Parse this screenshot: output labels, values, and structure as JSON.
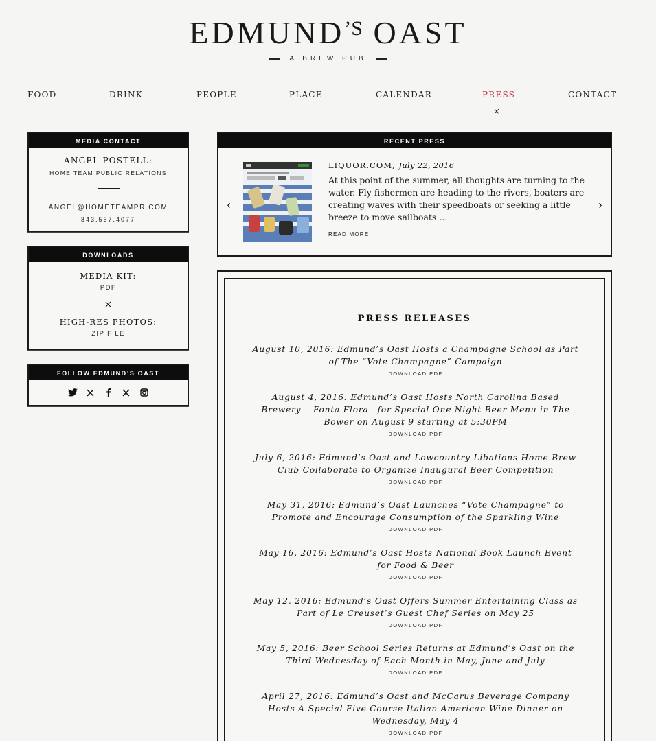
{
  "brand": {
    "name_main": "EDMUND",
    "name_apos": "’S",
    "name_end": "OAST",
    "tagline": "A BREW PUB"
  },
  "nav": {
    "items": [
      "FOOD",
      "DRINK",
      "PEOPLE",
      "PLACE",
      "CALENDAR",
      "PRESS",
      "CONTACT"
    ],
    "active": "PRESS",
    "active_mark": "×"
  },
  "media_contact": {
    "heading": "MEDIA CONTACT",
    "name": "ANGEL POSTELL:",
    "agency": "HOME TEAM PUBLIC RELATIONS",
    "email": "ANGEL@HOMETEAMPR.COM",
    "phone": "843.557.4077"
  },
  "downloads": {
    "heading": "DOWNLOADS",
    "media_kit_title": "MEDIA KIT:",
    "media_kit_link": "PDF",
    "separator": "×",
    "photos_title": "HIGH-RES PHOTOS:",
    "photos_link": "ZIP FILE"
  },
  "follow": {
    "heading": "FOLLOW EDMUND’S OAST",
    "icons": [
      "twitter-icon",
      "x-icon",
      "facebook-icon",
      "x-icon",
      "instagram-icon"
    ]
  },
  "recent_press": {
    "heading": "RECENT PRESS",
    "source": "LIQUOR.COM,",
    "date": "July 22, 2016",
    "excerpt": "At this point of the summer, all thoughts are turning to the water. Fly fishermen are heading to the rivers, boaters are creating waves with their speedboats or seeking a little breeze to move sailboats ...",
    "read_more": "READ MORE",
    "prev_arrow": "‹",
    "next_arrow": "›"
  },
  "press_releases": {
    "heading": "PRESS RELEASES",
    "download_label": "DOWNLOAD PDF",
    "items": [
      {
        "title": "August 10, 2016: Edmund’s Oast Hosts a Champagne School as Part of The “Vote Champagne” Campaign"
      },
      {
        "title": "August 4, 2016: Edmund’s Oast Hosts North Carolina Based Brewery —Fonta Flora—for Special One Night Beer Menu in The Bower on August 9 starting at 5:30PM"
      },
      {
        "title": "July 6, 2016: Edmund’s Oast and Lowcountry Libations Home Brew Club Collaborate to Organize Inaugural Beer Competition"
      },
      {
        "title": "May 31, 2016: Edmund’s Oast Launches “Vote Champagne” to Promote and Encourage Consumption of the Sparkling Wine"
      },
      {
        "title": "May 16, 2016: Edmund’s Oast Hosts National Book Launch Event for Food & Beer"
      },
      {
        "title": "May 12, 2016: Edmund’s Oast Offers Summer Entertaining Class as Part of Le Creuset’s Guest Chef Series on May 25"
      },
      {
        "title": "May 5, 2016: Beer School Series Returns at Edmund’s Oast on the Third Wednesday of Each Month in May, June and July"
      },
      {
        "title": "April 27, 2016: Edmund’s Oast and McCarus Beverage Company Hosts A Special Five Course Italian American Wine Dinner on Wednesday, May 4"
      }
    ]
  },
  "colors": {
    "active_nav": "#c8313a",
    "ink": "#111111",
    "paper": "#f5f5f3"
  }
}
